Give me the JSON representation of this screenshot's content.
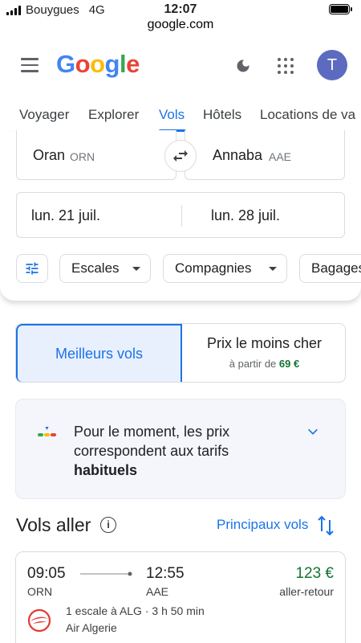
{
  "status_bar": {
    "carrier": "Bouygues",
    "network": "4G",
    "time": "12:07"
  },
  "browser": {
    "url": "google.com"
  },
  "header": {
    "logo_letters": [
      "G",
      "o",
      "o",
      "g",
      "l",
      "e"
    ],
    "logo_colors": [
      "#4285f4",
      "#ea4335",
      "#fbbc05",
      "#4285f4",
      "#34a853",
      "#ea4335"
    ],
    "avatar_letter": "T"
  },
  "tabs": [
    {
      "label": "Voyager"
    },
    {
      "label": "Explorer"
    },
    {
      "label": "Vols",
      "active": true
    },
    {
      "label": "Hôtels"
    },
    {
      "label": "Locations de va"
    }
  ],
  "search": {
    "origin_city": "Oran",
    "origin_code": "ORN",
    "dest_city": "Annaba",
    "dest_code": "AAE",
    "depart_date": "lun. 21 juil.",
    "return_date": "lun. 28 juil.",
    "filters": {
      "stops": "Escales",
      "airlines": "Compagnies",
      "bags": "Bagages"
    }
  },
  "sort": {
    "best_label": "Meilleurs vols",
    "cheapest_label": "Prix le moins cher",
    "cheapest_prefix": "à partir de",
    "cheapest_price": "69 €"
  },
  "insight": {
    "text_line1": "Pour le moment, les prix",
    "text_line2": "correspondent aux tarifs",
    "text_bold": "habituels"
  },
  "results": {
    "title": "Vols aller",
    "sort_link": "Principaux vols",
    "flights": [
      {
        "depart_time": "09:05",
        "depart_code": "ORN",
        "arrive_time": "12:55",
        "arrive_code": "AAE",
        "price": "123 €",
        "price_type": "aller-retour",
        "stops": "1 escale à ALG · 3 h 50 min",
        "airline": "Air Algerie"
      }
    ]
  },
  "colors": {
    "accent": "#1a73e8",
    "price_green": "#137333",
    "airline_red": "#e53935"
  }
}
